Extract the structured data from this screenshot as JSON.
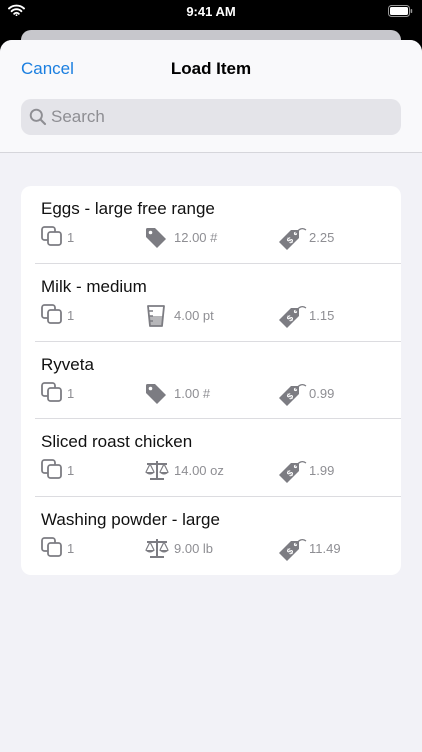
{
  "status_bar": {
    "time": "9:41 AM"
  },
  "nav": {
    "cancel_label": "Cancel",
    "title": "Load Item"
  },
  "search": {
    "placeholder": "Search",
    "value": ""
  },
  "items": [
    {
      "name": "Eggs - large free range",
      "quantity": "1",
      "size": "12.00 #",
      "size_icon": "tag-icon",
      "price": "2.25"
    },
    {
      "name": "Milk - medium",
      "quantity": "1",
      "size": "4.00 pt",
      "size_icon": "measuring-cup-icon",
      "price": "1.15"
    },
    {
      "name": "Ryveta",
      "quantity": "1",
      "size": "1.00 #",
      "size_icon": "tag-icon",
      "price": "0.99"
    },
    {
      "name": "Sliced roast chicken",
      "quantity": "1",
      "size": "14.00 oz",
      "size_icon": "scale-icon",
      "price": "1.99"
    },
    {
      "name": "Washing powder - large",
      "quantity": "1",
      "size": "9.00 lb",
      "size_icon": "scale-icon",
      "price": "11.49"
    }
  ],
  "colors": {
    "accent": "#1b7fe0",
    "icon_gray": "#7c7c82",
    "background": "#f2f2f7"
  }
}
